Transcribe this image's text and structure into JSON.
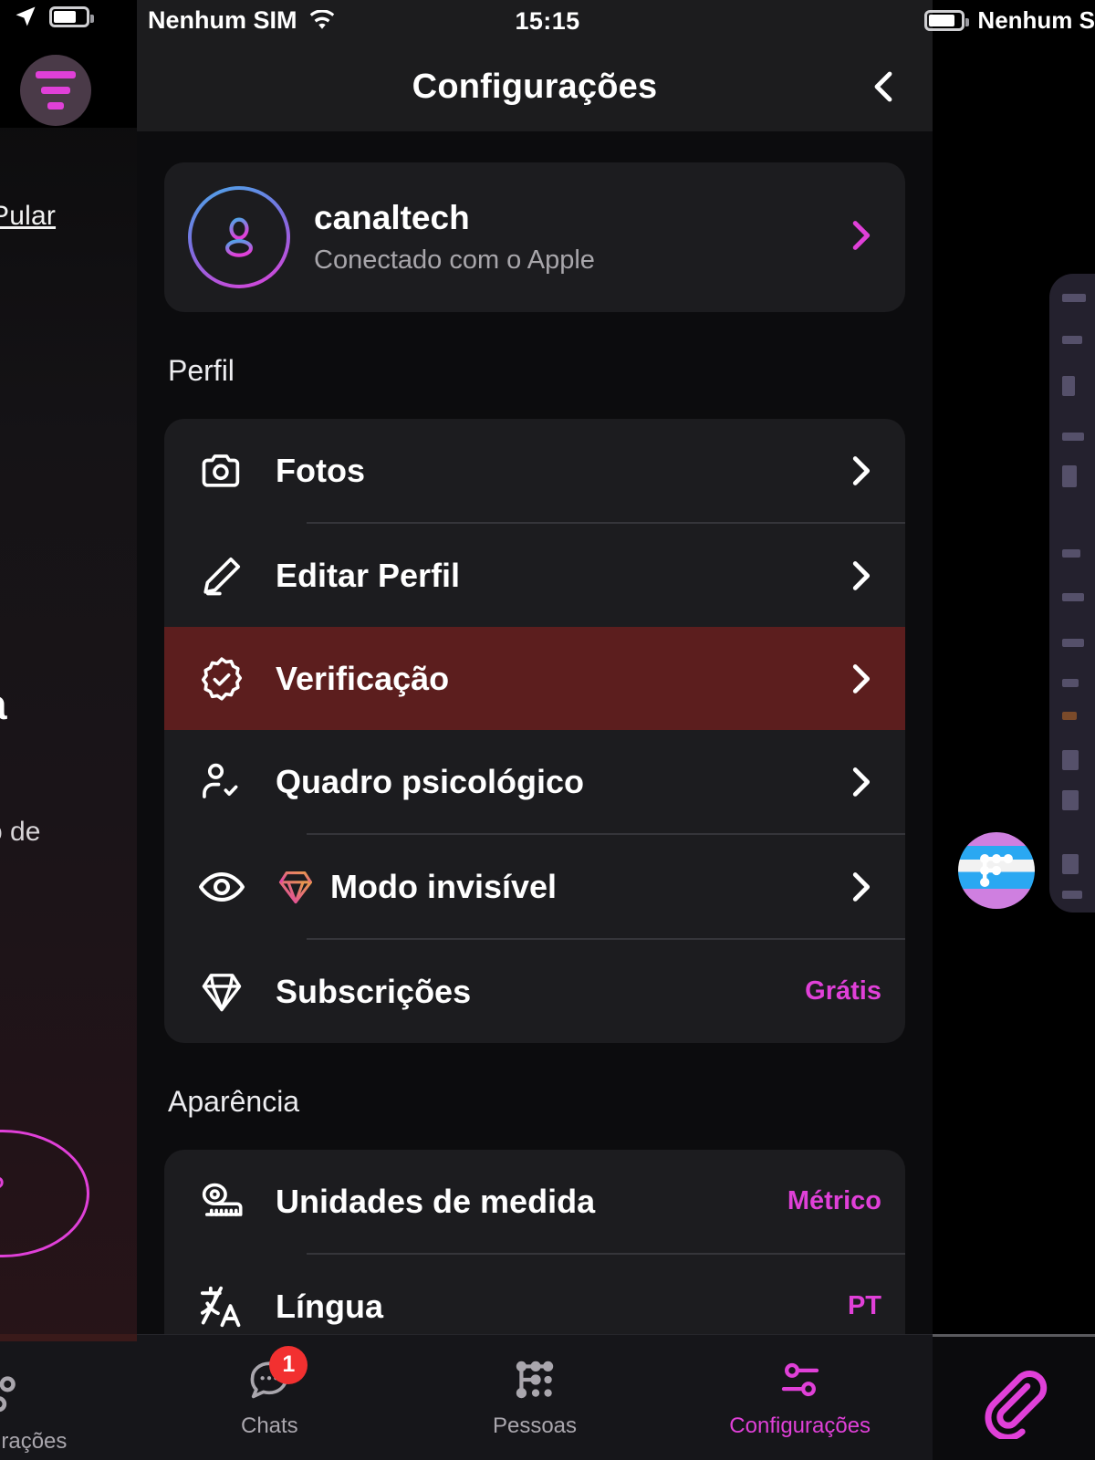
{
  "status_bar": {
    "location_icon": "location-arrow-icon",
    "battery_icon": "battery-icon",
    "carrier_left": "Nenhum SIM",
    "wifi_icon": "wifi-icon",
    "time": "15:15",
    "carrier_right": "Nenhum S"
  },
  "background": {
    "filter_button_icon": "filter-icon",
    "skip_link": "Pular",
    "fragment_heading": "a",
    "fragment_text": "o de",
    "circle_glyph": "?",
    "right_avatar_icon": "network-graph-icon",
    "attachment_icon": "paperclip-icon",
    "bottom_left_tab_label": "urações",
    "bottom_left_tab_icon": "sliders-icon"
  },
  "navbar": {
    "title": "Configurações",
    "back_icon": "chevron-left-icon"
  },
  "profile": {
    "avatar_icon": "user-avatar-icon",
    "name": "canaltech",
    "subtitle": "Conectado com o Apple",
    "chevron_icon": "chevron-right-icon",
    "accent_color": "#e040d8"
  },
  "sections": [
    {
      "title": "Perfil",
      "rows": [
        {
          "icon": "camera-icon",
          "label": "Fotos",
          "value": "",
          "chevron": true,
          "highlight": false,
          "divider_after": true
        },
        {
          "icon": "pencil-icon",
          "label": "Editar Perfil",
          "value": "",
          "chevron": true,
          "highlight": false,
          "divider_after": false
        },
        {
          "icon": "verified-badge-icon",
          "label": "Verificação",
          "value": "",
          "chevron": true,
          "highlight": true,
          "divider_after": false
        },
        {
          "icon": "person-check-icon",
          "label": "Quadro psicológico",
          "value": "",
          "chevron": true,
          "highlight": false,
          "divider_after": true
        },
        {
          "icon": "eye-icon",
          "label": "Modo invisível",
          "value": "",
          "chevron": true,
          "highlight": false,
          "divider_after": true,
          "prefix_icon": "diamond-gradient-icon"
        },
        {
          "icon": "diamond-icon",
          "label": "Subscrições",
          "value": "Grátis",
          "chevron": false,
          "highlight": false,
          "divider_after": false
        }
      ]
    },
    {
      "title": "Aparência",
      "rows": [
        {
          "icon": "tape-measure-icon",
          "label": "Unidades de medida",
          "value": "Métrico",
          "chevron": false,
          "highlight": false,
          "divider_after": true
        },
        {
          "icon": "translate-icon",
          "label": "Língua",
          "value": "PT",
          "chevron": false,
          "highlight": false,
          "divider_after": false
        }
      ]
    }
  ],
  "tabbar": {
    "tabs": [
      {
        "icon": "chat-bubble-icon",
        "label": "Chats",
        "badge": "1",
        "active": false
      },
      {
        "icon": "network-graph-icon",
        "label": "Pessoas",
        "badge": "",
        "active": false
      },
      {
        "icon": "sliders-icon",
        "label": "Configurações",
        "badge": "",
        "active": true
      }
    ]
  },
  "colors": {
    "accent": "#e040d8",
    "highlight_row": "#5c1e1e",
    "card_bg": "#1c1c1f",
    "screen_bg": "#0c0c0e",
    "badge_red": "#f23030"
  }
}
